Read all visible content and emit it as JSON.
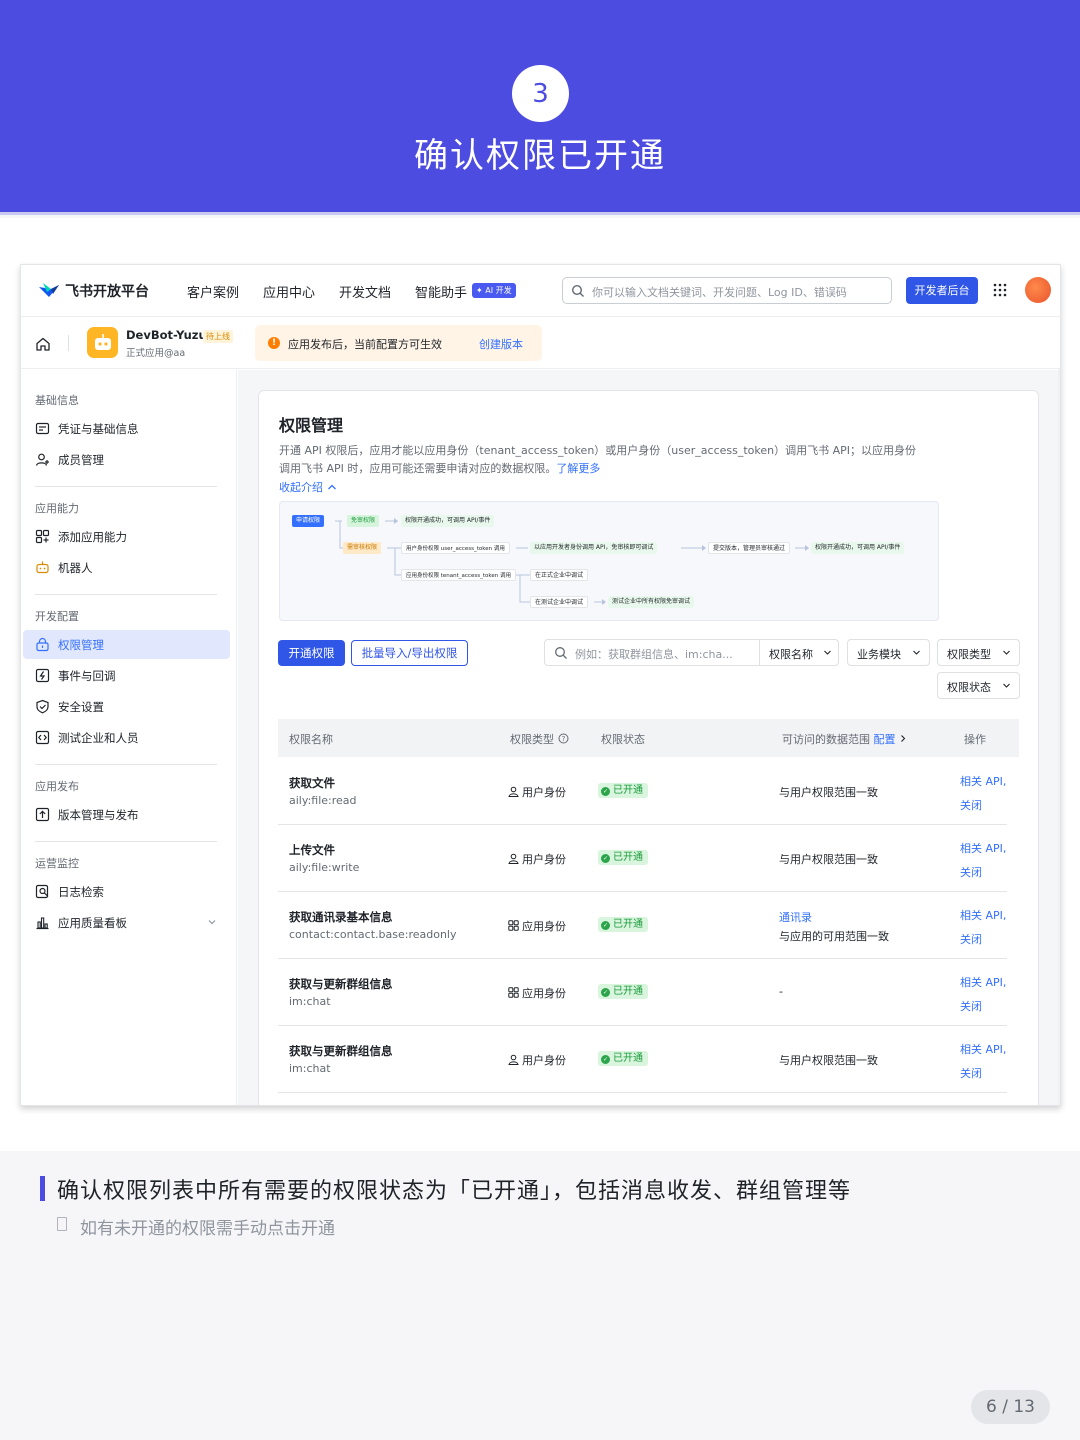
{
  "slide": {
    "step": "3",
    "title": "确认权限已开通",
    "caption": "确认权限列表中所有需要的权限状态为「已开通」，包括消息收发、群组管理等",
    "hint": "如有未开通的权限需手动点击开通",
    "page": "6 / 13",
    "accent_color": "#4d4ce0"
  },
  "topnav": {
    "logo": "飞书开放平台",
    "items": [
      "客户案例",
      "应用中心",
      "开发文档",
      "智能助手"
    ],
    "ai_badge": "✦ AI 开发",
    "search_placeholder": "你可以输入文档关键词、开发问题、Log ID、错误码",
    "dev_button": "开发者后台"
  },
  "appbar": {
    "app_name": "DevBot-Yuzu",
    "app_tag": "待上线",
    "app_sub": "正式应用@aa",
    "notice": "应用发布后，当前配置方可生效",
    "notice_link": "创建版本"
  },
  "sidebar": {
    "groups": [
      {
        "label": "基础信息",
        "items": [
          {
            "label": "凭证与基础信息",
            "icon": "id-card-icon"
          },
          {
            "label": "成员管理",
            "icon": "user-add-icon"
          }
        ]
      },
      {
        "label": "应用能力",
        "items": [
          {
            "label": "添加应用能力",
            "icon": "apps-icon"
          },
          {
            "label": "机器人",
            "icon": "robot-icon"
          }
        ]
      },
      {
        "label": "开发配置",
        "items": [
          {
            "label": "权限管理",
            "icon": "lock-icon"
          },
          {
            "label": "事件与回调",
            "icon": "event-icon"
          },
          {
            "label": "安全设置",
            "icon": "shield-icon"
          },
          {
            "label": "测试企业和人员",
            "icon": "code-icon"
          }
        ]
      },
      {
        "label": "应用发布",
        "items": [
          {
            "label": "版本管理与发布",
            "icon": "upload-icon"
          }
        ]
      },
      {
        "label": "运营监控",
        "items": [
          {
            "label": "日志检索",
            "icon": "log-search-icon"
          },
          {
            "label": "应用质量看板",
            "icon": "chart-icon"
          }
        ]
      }
    ]
  },
  "card": {
    "title": "权限管理",
    "desc_1": "开通 API 权限后，应用才能以应用身份（tenant_access_token）或用户身份（user_access_token）调用飞书 API；以应用身份",
    "desc_2": "调用飞书 API 时，应用可能还需要申请对应的数据权限。",
    "learn_more": "了解更多",
    "collapse": "收起介绍",
    "flow": {
      "apply": "申请权限",
      "no_review": "免审权限",
      "no_review_ok": "权限开通成功，可调用 API/事件",
      "need_review": "需审核权限",
      "user_token": "用户身份权限 user_access_token 调用",
      "dev_debug": "以应用开发者身份调用 API，免审核即可调试",
      "publish": "提交版本，管理员审核通过",
      "final_ok": "权限开通成功，可调用 API/事件",
      "tenant_token": "应用身份权限 tenant_access_token 调用",
      "prod_debug": "在正式企业中调试",
      "test_debug": "在测试企业中调试",
      "test_ok": "测试企业中所有权限免审调试"
    },
    "buttons": {
      "enable": "开通权限",
      "batch": "批量导入/导出权限"
    },
    "filters": {
      "search_placeholder": "例如：获取群组信息、im:cha...",
      "scope": "权限名称",
      "module": "业务模块",
      "type": "权限类型",
      "status": "权限状态"
    },
    "table": {
      "headers": {
        "name": "权限名称",
        "type": "权限类型",
        "status": "权限状态",
        "scope": "可访问的数据范围",
        "config": "配置",
        "op": "操作"
      },
      "rows": [
        {
          "name": "获取文件",
          "code": "aily:file:read",
          "type": "用户身份",
          "type_icon": "user-icon",
          "status": "已开通",
          "scope": "与用户权限范围一致",
          "op1": "相关 API,",
          "op2": "关闭"
        },
        {
          "name": "上传文件",
          "code": "aily:file:write",
          "type": "用户身份",
          "type_icon": "user-icon",
          "status": "已开通",
          "scope": "与用户权限范围一致",
          "op1": "相关 API,",
          "op2": "关闭"
        },
        {
          "name": "获取通讯录基本信息",
          "code": "contact:contact.base:readonly",
          "type": "应用身份",
          "type_icon": "app-icon",
          "status": "已开通",
          "scope_link": "通讯录",
          "scope": "与应用的可用范围一致",
          "op1": "相关 API,",
          "op2": "关闭"
        },
        {
          "name": "获取与更新群组信息",
          "code": "im:chat",
          "type": "应用身份",
          "type_icon": "app-icon",
          "status": "已开通",
          "scope": "-",
          "op1": "相关 API,",
          "op2": "关闭"
        },
        {
          "name": "获取与更新群组信息",
          "code": "im:chat",
          "type": "用户身份",
          "type_icon": "user-icon",
          "status": "已开通",
          "scope": "与用户权限范围一致",
          "op1": "相关 API,",
          "op2": "关闭"
        }
      ]
    }
  }
}
